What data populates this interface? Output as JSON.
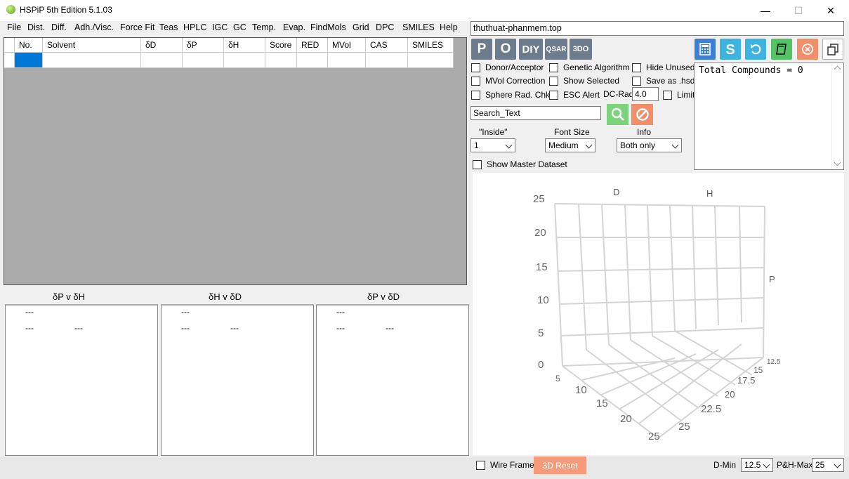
{
  "window": {
    "title": "HSPiP 5th Edition 5.1.03",
    "minimize": "—",
    "maximize": "☐",
    "close": "✕"
  },
  "menu": [
    "File",
    "Dist.",
    "Diff.",
    "Adh./Visc.",
    "Force Fit",
    "Teas",
    "HPLC",
    "IGC",
    "GC",
    "Temp.",
    "Evap.",
    "FindMols",
    "Grid",
    "DPC",
    "SMILES",
    "Help"
  ],
  "url_text": "thuthuat-phanmem.top",
  "table": {
    "columns": [
      "No.",
      "Solvent",
      "δD",
      "δP",
      "δH",
      "Score",
      "RED",
      "MVol",
      "CAS",
      "SMILES"
    ]
  },
  "mini_plots": [
    {
      "title": "δP v δH",
      "top_dash": "---",
      "left_dash": "---",
      "right_dash": "---"
    },
    {
      "title": "δH v δD",
      "top_dash": "---",
      "left_dash": "---",
      "right_dash": "---"
    },
    {
      "title": "δP v δD",
      "top_dash": "---",
      "left_dash": "---",
      "right_dash": "---"
    }
  ],
  "toolbar": {
    "p": "P",
    "o": "O",
    "diy": "DIY",
    "qsar": "QSAR",
    "three_do": "3DO"
  },
  "options": {
    "donor_acceptor": "Donor/Acceptor",
    "genetic_algorithm": "Genetic Algorithm",
    "hide_unused": "Hide Unused",
    "mvol_correction": "MVol Correction",
    "show_selected": "Show Selected",
    "save_as_hsd": "Save as .hsd",
    "sphere_rad_chk": "Sphere Rad. Chk",
    "esc_alert": "ESC Alert",
    "dc_rad_label": "DC-Rad",
    "dc_rad_value": "4.0",
    "limit": "Limit"
  },
  "search": {
    "value": "Search_Text"
  },
  "dropdowns": {
    "inside_label": "\"Inside\"",
    "inside_value": "1",
    "font_size_label": "Font Size",
    "font_size_value": "Medium",
    "info_label": "Info",
    "info_value": "Both only"
  },
  "show_master": "Show Master Dataset",
  "info_text": "Total Compounds = 0",
  "plot3d": {
    "axis_d": "D",
    "axis_h": "H",
    "axis_p": "P",
    "p_ticks": [
      "25",
      "20",
      "15",
      "10",
      "5",
      "0"
    ],
    "d_ticks": [
      "5",
      "10",
      "15",
      "20",
      "25"
    ],
    "h_ticks": [
      "12.5",
      "15",
      "17.5",
      "20",
      "22.5",
      "25"
    ]
  },
  "bottom": {
    "wire_frame": "Wire Frame",
    "reset": "3D Reset",
    "dmin_label": "D-Min",
    "dmin_value": "12.5",
    "phmax_label": "P&H-Max",
    "phmax_value": "25"
  },
  "colors": {
    "blue_btn": "#3d7fd6",
    "cyan_btn": "#3db4e0",
    "green_btn": "#55c266",
    "orange_btn": "#f28f6b",
    "reset_btn": "#f59b7a"
  }
}
